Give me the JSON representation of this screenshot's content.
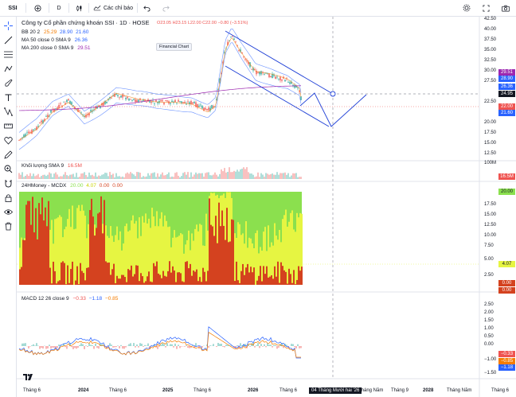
{
  "topbar": {
    "symbol": "SSI",
    "interval": "D",
    "indicators_label": "Các chỉ báo"
  },
  "legend": {
    "title": "Công ty Cổ phần chứng khoán SSI · 1D · HOSE",
    "ohlc": "O23.05 H23.15 L22.00 C22.00 −0.80 (−3.51%)",
    "bb": "BB 20 2",
    "bb_values": [
      "25.29",
      "28.90",
      "21.60"
    ],
    "ma50": "MA 50 close 0 SMA 9",
    "ma50_value": "26.36",
    "ma200": "MA 200 close 0 SMA 9",
    "ma200_value": "29.51",
    "financial_chart": "Financial Chart",
    "volume": "Khối lượng SMA 9",
    "volume_value": "16.5M",
    "mcdx": "24HMoney - MCDX",
    "mcdx_values": [
      "20.00",
      "4.07",
      "0.00",
      "0.00"
    ],
    "macd": "MACD 12 26 close 9",
    "macd_values": [
      "−0.33",
      "−1.18",
      "−0.85"
    ]
  },
  "price_axis": [
    "42.50",
    "40.00",
    "37.50",
    "35.00",
    "32.50",
    "30.00",
    "27.50",
    "25.00",
    "22.50",
    "20.00",
    "17.50",
    "15.00",
    "12.50"
  ],
  "volume_axis": [
    "100M"
  ],
  "mcdx_axis": [
    "17.50",
    "15.00",
    "12.50",
    "10.00",
    "7.50",
    "5.00",
    "2.50"
  ],
  "macd_axis": [
    "2.50",
    "2.00",
    "1.50",
    "1.00",
    "0.50",
    "0.00",
    "−0.50",
    "−1.00",
    "−1.50"
  ],
  "tags": {
    "price_29_51": "29.51",
    "price_28_90": "28.90",
    "price_26_36": "26.36",
    "price_24_95": "24.95",
    "price_22_00": "22.00",
    "price_21_60": "21.60",
    "vol_16_5": "16.5M",
    "mcdx_20": "20.00",
    "mcdx_4_07": "4.07",
    "mcdx_0a": "0.00",
    "mcdx_0b": "0.00",
    "macd_033": "−0.33",
    "macd_085": "−0.85",
    "macd_118": "−1.18"
  },
  "time_axis": [
    "Tháng 6",
    "2024",
    "Tháng 6",
    "2025",
    "Tháng 6",
    "2026",
    "Tháng 6",
    "Tháng Năm",
    "Tháng 9",
    "2028",
    "Tháng Năm",
    "Tháng 6"
  ],
  "crosshair_date": "04 Tháng Mười hai '26",
  "colors": {
    "up": "#26a69a",
    "down": "#ef5350",
    "bb": "#2962ff",
    "ma200": "#9c27b0",
    "mcdx_green": "#8be04e",
    "mcdx_yellow": "#e6f542",
    "mcdx_red": "#d4421f",
    "channel": "#1e3fd6"
  }
}
